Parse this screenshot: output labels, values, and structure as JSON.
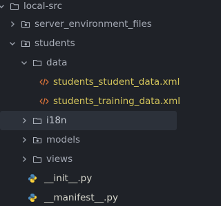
{
  "tree": {
    "items": [
      {
        "label": "local-src",
        "kind": "folder",
        "state": "expanded"
      },
      {
        "label": "server_environment_files",
        "kind": "folder-module",
        "state": "collapsed"
      },
      {
        "label": "students",
        "kind": "folder-module",
        "state": "expanded"
      },
      {
        "label": "data",
        "kind": "folder",
        "state": "expanded"
      },
      {
        "label": "students_student_data.xml",
        "kind": "xml-file"
      },
      {
        "label": "students_training_data.xml",
        "kind": "xml-file"
      },
      {
        "label": "i18n",
        "kind": "folder",
        "state": "collapsed",
        "selected": true
      },
      {
        "label": "models",
        "kind": "folder-module",
        "state": "collapsed"
      },
      {
        "label": "views",
        "kind": "folder",
        "state": "collapsed"
      },
      {
        "label": "__init__.py",
        "kind": "python-file"
      },
      {
        "label": "__manifest__.py",
        "kind": "python-file"
      }
    ]
  },
  "colors": {
    "background": "#1f2228",
    "selected_row": "#2c313a",
    "xml_text": "#d3c45b",
    "xml_icon": "#e0753a",
    "python_blue": "#4b8bbe",
    "python_yellow": "#ffd43b"
  }
}
